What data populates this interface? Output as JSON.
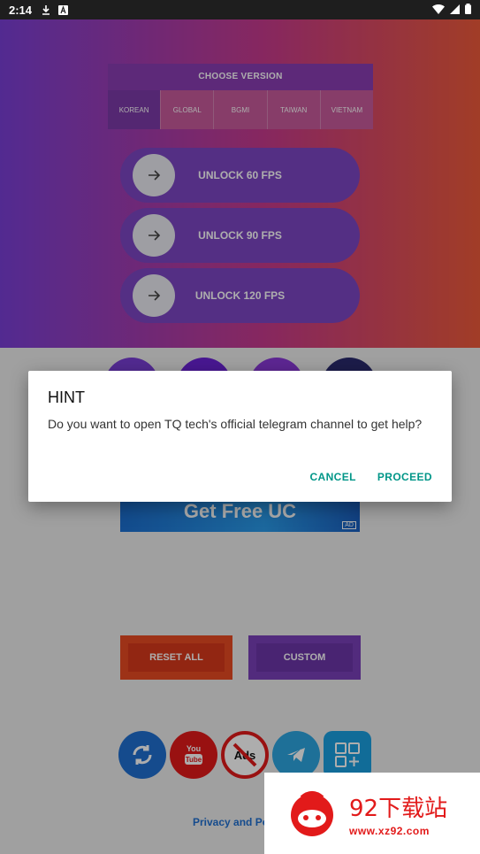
{
  "status_bar": {
    "time": "2:14"
  },
  "header": {
    "choose_version_title": "CHOOSE VERSION",
    "versions": [
      {
        "label": "KOREAN",
        "active": true
      },
      {
        "label": "GLOBAL",
        "active": false
      },
      {
        "label": "BGMI",
        "active": false
      },
      {
        "label": "TAIWAN",
        "active": false
      },
      {
        "label": "VIETNAM",
        "active": false
      }
    ],
    "unlock_buttons": [
      {
        "label": "UNLOCK 60 FPS"
      },
      {
        "label": "UNLOCK 90 FPS"
      },
      {
        "label": "UNLOCK 120 FPS"
      }
    ]
  },
  "ad": {
    "text": "Get Free UC",
    "badge": "AD"
  },
  "actions": {
    "reset_label": "RESET ALL",
    "custom_label": "CUSTOM"
  },
  "bottom_icons": [
    "refresh-icon",
    "youtube-icon",
    "no-ads-icon",
    "telegram-icon",
    "more-apps-icon"
  ],
  "privacy_text": "Privacy and Po",
  "dialog": {
    "title": "HINT",
    "message": "Do you want to open TQ tech's official telegram channel to get help?",
    "cancel_label": "CANCEL",
    "proceed_label": "PROCEED"
  },
  "watermark": {
    "chinese": "92下载站",
    "url": "www.xz92.com"
  },
  "colors": {
    "accent": "#009688",
    "header_start": "#7a3fd6",
    "header_end": "#ee5a3a",
    "reset": "#e84a22",
    "custom": "#7a40b8"
  }
}
